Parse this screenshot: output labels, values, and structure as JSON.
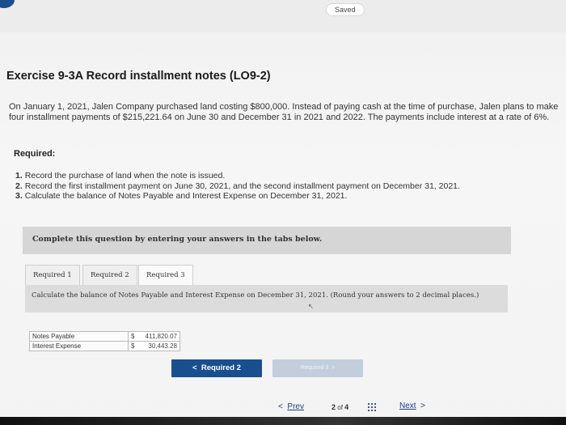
{
  "header": {
    "saved_label": "Saved"
  },
  "exercise": {
    "title": "Exercise 9-3A Record installment notes (LO9-2)",
    "intro": "On January 1, 2021, Jalen Company purchased land costing $800,000. Instead of paying cash at the time of purchase, Jalen plans to make four installment payments of $215,221.64 on June 30 and December 31 in 2021 and 2022. The payments include interest at a rate of 6%.",
    "required_label": "Required:",
    "requirements": [
      {
        "num": "1.",
        "text": "Record the purchase of land when the note is issued."
      },
      {
        "num": "2.",
        "text": "Record the first installment payment on June 30, 2021, and the second installment payment on December 31, 2021."
      },
      {
        "num": "3.",
        "text": "Calculate the balance of Notes Payable and Interest Expense on December 31, 2021."
      }
    ]
  },
  "panel": {
    "text": "Complete this question by entering your answers in the tabs below."
  },
  "tabs": [
    {
      "label": "Required 1",
      "active": false
    },
    {
      "label": "Required 2",
      "active": false
    },
    {
      "label": "Required 3",
      "active": true
    }
  ],
  "content": {
    "instructions": "Calculate the balance of Notes Payable and Interest Expense on December 31, 2021. (Round your answers to 2 decimal places.)"
  },
  "answers": [
    {
      "label": "Notes Payable",
      "currency": "$",
      "value": "411,820.07"
    },
    {
      "label": "Interest Expense",
      "currency": "$",
      "value": "30,443.28"
    }
  ],
  "nav_buttons": {
    "prev_req": {
      "arrow": "<",
      "label": "Required 2"
    },
    "next_req": {
      "label": "Required 3",
      "arrow": ">"
    }
  },
  "footer": {
    "prev_arrow": "<",
    "prev_label": "Prev",
    "page_current": "2",
    "page_of": "of",
    "page_total": "4",
    "next_label": "Next",
    "next_arrow": ">"
  },
  "colors": {
    "accent": "#1a4f8f",
    "link": "#1e3f86",
    "disabled_button": "#c3cedc"
  }
}
